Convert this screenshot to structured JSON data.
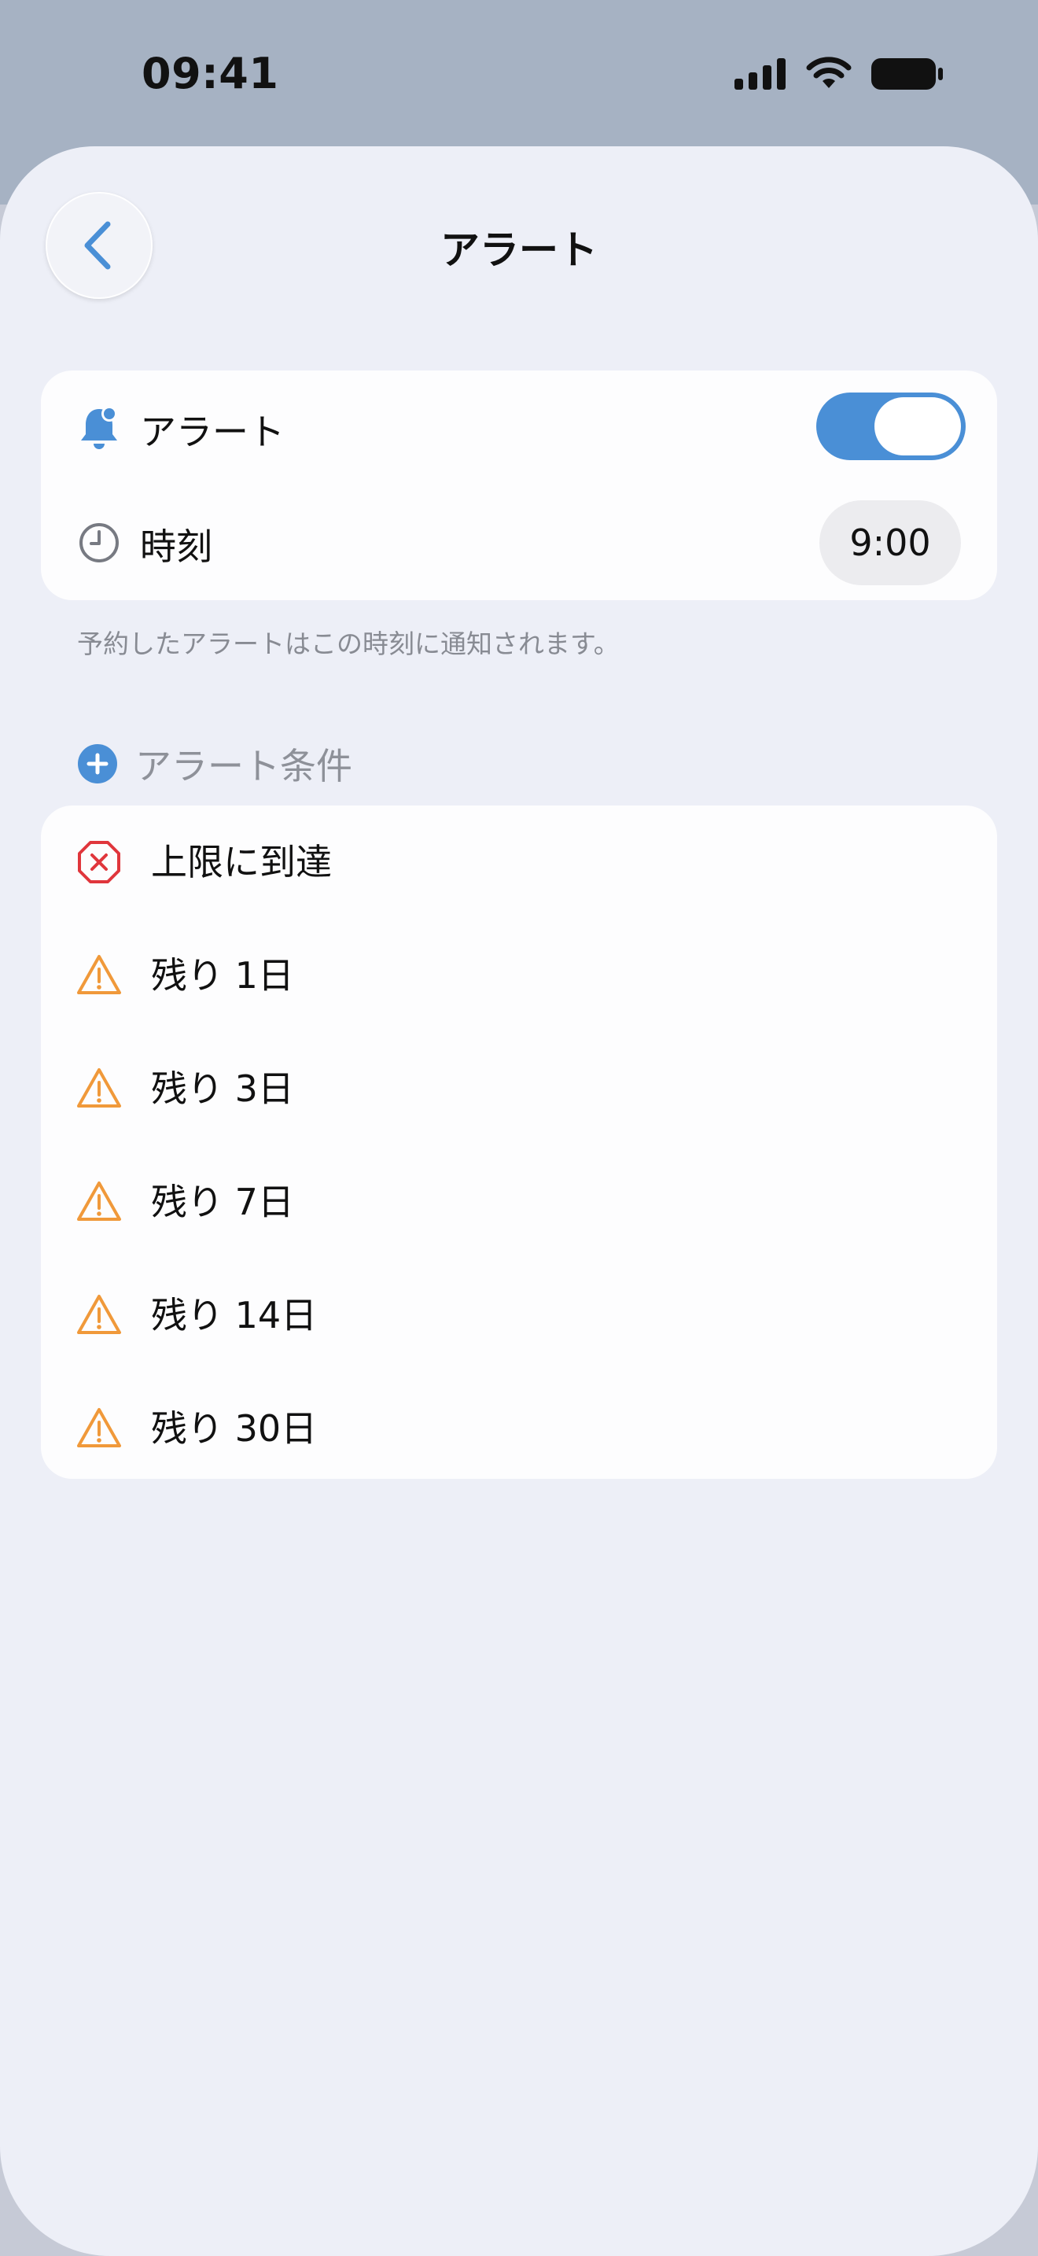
{
  "status_bar": {
    "time": "09:41",
    "icons": [
      "cellular-signal-icon",
      "wifi-icon",
      "battery-icon"
    ]
  },
  "nav": {
    "back_icon": "chevron-left-icon",
    "title": "アラート"
  },
  "settings": {
    "alert_row": {
      "icon": "bell-badge-icon",
      "label": "アラート",
      "toggle_on": true
    },
    "time_row": {
      "icon": "clock-icon",
      "label": "時刻",
      "value": "9:00"
    },
    "footnote": "予約したアラートはこの時刻に通知されます。"
  },
  "conditions": {
    "header_icon": "plus-circle-icon",
    "header_label": "アラート条件",
    "items": [
      {
        "icon": "x-octagon-icon",
        "label": "上限に到達"
      },
      {
        "icon": "warning-triangle-icon",
        "label": "残り 1日"
      },
      {
        "icon": "warning-triangle-icon",
        "label": "残り 3日"
      },
      {
        "icon": "warning-triangle-icon",
        "label": "残り 7日"
      },
      {
        "icon": "warning-triangle-icon",
        "label": "残り 14日"
      },
      {
        "icon": "warning-triangle-icon",
        "label": "残り 30日"
      }
    ]
  },
  "colors": {
    "accent": "#4a8fd6",
    "danger": "#e0363c",
    "warning": "#f0993a",
    "secondary_text": "#888b93",
    "sheet_background": "#edeff7"
  }
}
